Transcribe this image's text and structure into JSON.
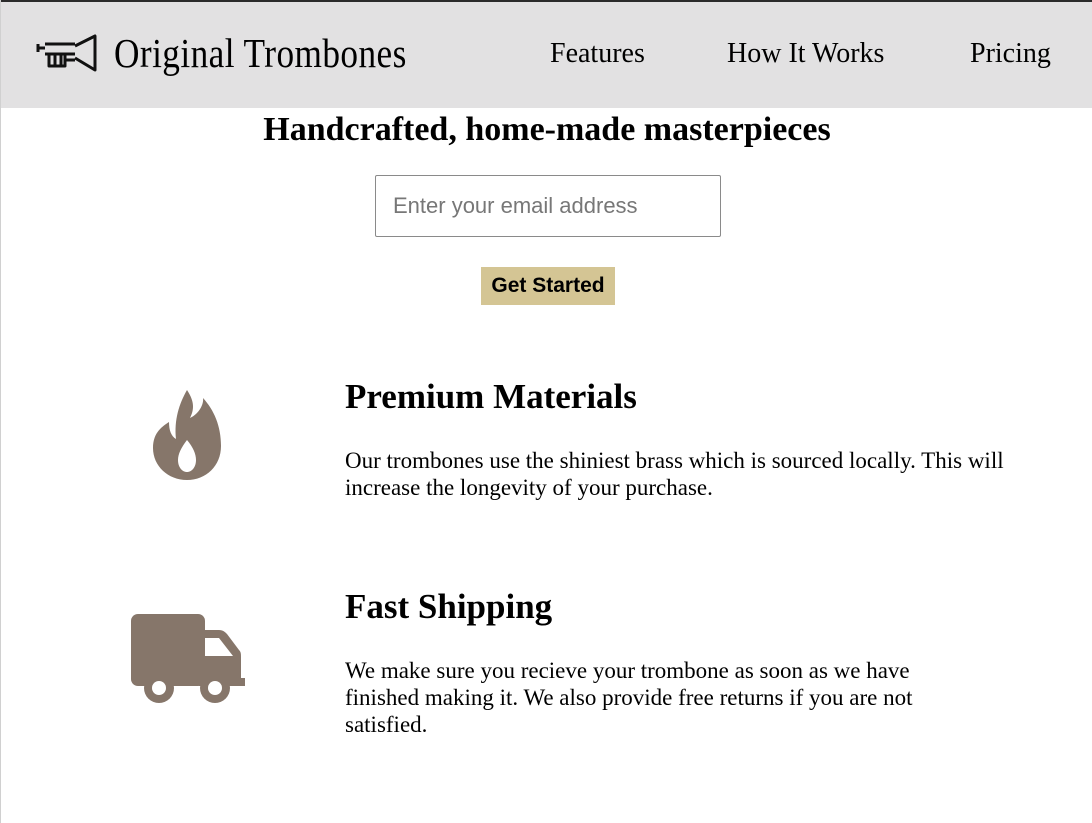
{
  "header": {
    "brand": "Original Trombones",
    "logo_icon": "trombone-icon",
    "nav": [
      {
        "label": "Features"
      },
      {
        "label": "How It Works"
      },
      {
        "label": "Pricing"
      }
    ]
  },
  "hero": {
    "title": "Handcrafted, home-made masterpieces",
    "email_placeholder": "Enter your email address",
    "cta_label": "Get Started"
  },
  "features": [
    {
      "icon": "fire-icon",
      "title": "Premium Materials",
      "description": "Our trombones use the shiniest brass which is sourced locally. This will increase the longevity of your purchase."
    },
    {
      "icon": "truck-icon",
      "title": "Fast Shipping",
      "description": "We make sure you recieve your trombone as soon as we have finished making it. We also provide free returns if you are not satisfied."
    }
  ],
  "colors": {
    "header_bg": "#e2e1e2",
    "button_bg": "#d4c594",
    "icon_color": "#86766a"
  }
}
